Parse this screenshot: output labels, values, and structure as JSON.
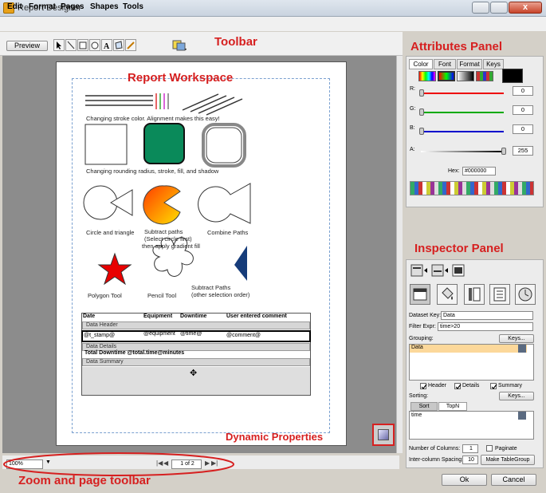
{
  "window": {
    "title": "Report Designer",
    "close": "x"
  },
  "menu": [
    "Edit",
    "Format",
    "Pages",
    "Shapes",
    "Tools"
  ],
  "toolbar": {
    "preview": "Preview"
  },
  "annotations": {
    "toolbar": "Toolbar",
    "workspace": "Report Workspace",
    "attributes": "Attributes Panel",
    "inspector": "Inspector Panel",
    "dynamic": "Dynamic Properties",
    "zoom": "Zoom and page toolbar"
  },
  "captions": {
    "stroke": "Changing stroke color. Alignment makes this easy!",
    "rounding": "Changing rounding radius, stroke, fill, and shadow",
    "circle": "Circle and triangle",
    "subtract1": "Subtract paths",
    "subtract2": "(Select circle first)",
    "subtract3": "then apply gradient fill",
    "combine": "Combine Paths",
    "polygon": "Polygon Tool",
    "pencil": "Pencil Tool",
    "subtract_other1": "Subtract Paths",
    "subtract_other2": "(other selection order)"
  },
  "table": {
    "headers": [
      "Date",
      "Equipment",
      "Downtime",
      "User entered comment"
    ],
    "data_header": "Data Header",
    "cells": [
      "@t_stamp@",
      "@equipment",
      "@time@",
      "@comment@"
    ],
    "data_details": "Data Details",
    "total": "Total Downtime @total.time@minutes",
    "data_summary": "Data Summary"
  },
  "attributes": {
    "tabs": [
      "Color",
      "Font",
      "Format",
      "Keys"
    ],
    "r_label": "R:",
    "g_label": "G:",
    "b_label": "B:",
    "a_label": "A:",
    "r": "0",
    "g": "0",
    "b": "0",
    "a": "255",
    "hex_label": "Hex:",
    "hex": "#000000"
  },
  "inspector": {
    "dataset_key_label": "Dataset Key:",
    "dataset_key": "Data",
    "filter_label": "Filter Expr:",
    "filter": "time>20",
    "grouping_label": "Grouping:",
    "keys_btn": "Keys...",
    "grouping_item": "Data",
    "header_chk": "Header",
    "details_chk": "Details",
    "summary_chk": "Summary",
    "sorting_label": "Sorting:",
    "keys_btn2": "Keys...",
    "sort_tab": "Sort",
    "topn_tab": "TopN",
    "sort_item": "time",
    "columns_label": "Number of Columns:",
    "columns": "1",
    "paginate": "Paginate",
    "spacing_label": "Inter-column Spacing:",
    "spacing": "10",
    "make_table_group": "Make TableGroup"
  },
  "bottom": {
    "zoom": "100%",
    "page": "1 of 2",
    "ok": "Ok",
    "cancel": "Cancel"
  },
  "colors": {
    "accent": "#d62020",
    "palette_green": "#0a8a5a",
    "dark_blue": "#163c7a"
  }
}
